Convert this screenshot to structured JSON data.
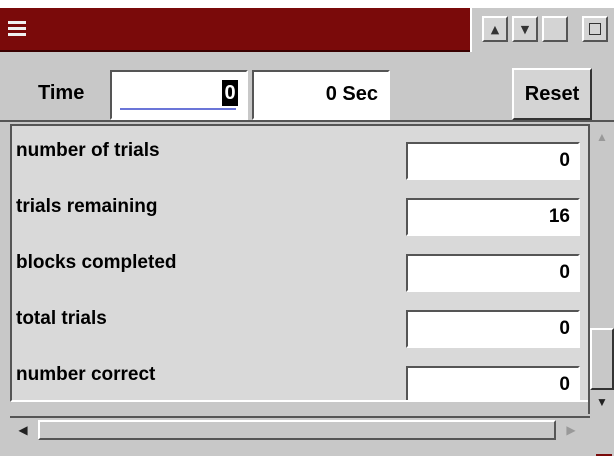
{
  "window": {
    "title": "",
    "titlebar_color": "#7a0a0a",
    "menu_icon": "window-menu-icon",
    "controls": [
      {
        "name": "minimize",
        "icon": "minimize-icon"
      },
      {
        "name": "restore",
        "icon": "restore-icon"
      },
      {
        "name": "maximize",
        "icon": "maximize-icon"
      },
      {
        "name": "extra",
        "icon": "small-box-icon"
      }
    ]
  },
  "toolbar": {
    "time_label": "Time",
    "time_value": "0",
    "seconds_display": "0 Sec",
    "reset_label": "Reset"
  },
  "stats": [
    {
      "label": "number of trials",
      "value": "0"
    },
    {
      "label": "trials remaining",
      "value": "16"
    },
    {
      "label": "blocks completed",
      "value": "0"
    },
    {
      "label": "total trials",
      "value": "0"
    },
    {
      "label": "number correct",
      "value": "0"
    }
  ],
  "scrollbars": {
    "up_icon": "arrow-up-icon",
    "down_icon": "arrow-down-icon",
    "left_icon": "arrow-left-icon",
    "right_icon": "arrow-right-icon"
  }
}
